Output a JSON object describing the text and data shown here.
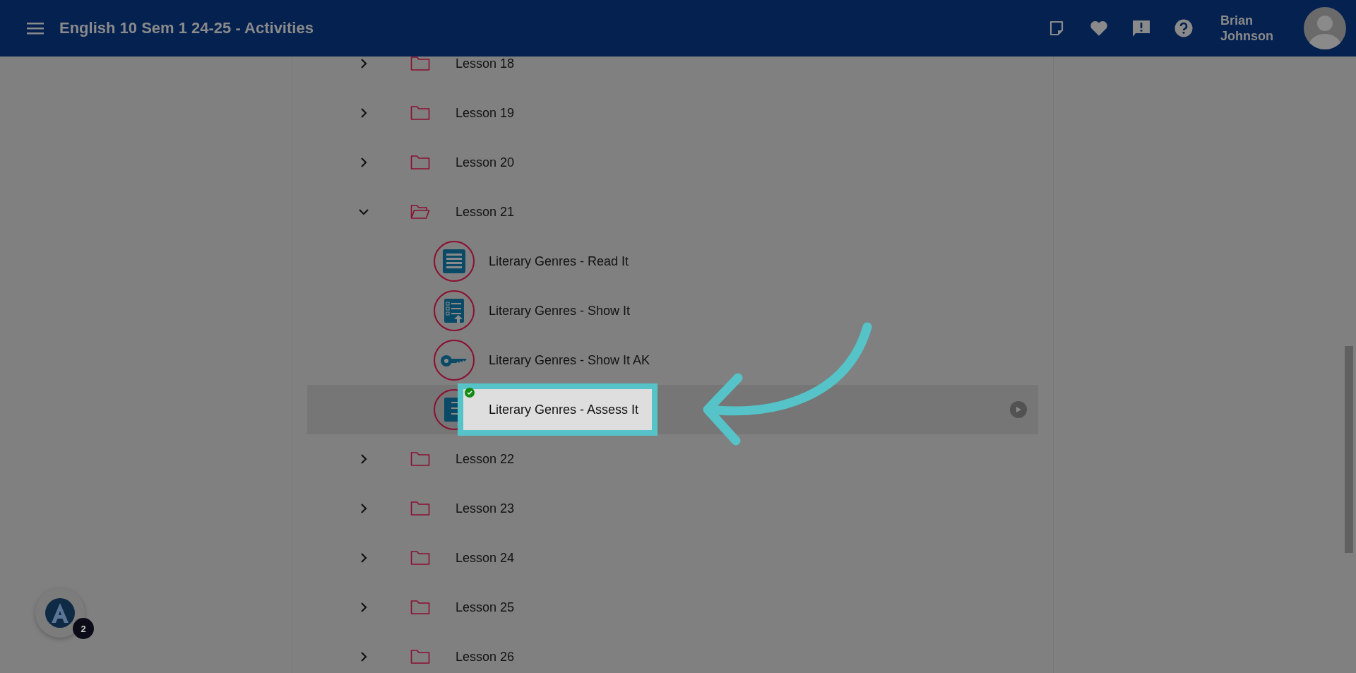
{
  "header": {
    "title": "English 10 Sem 1 24-25 - Activities",
    "user_name": "Brian Johnson"
  },
  "lessons": [
    {
      "label": "Lesson 18",
      "expanded": false
    },
    {
      "label": "Lesson 19",
      "expanded": false
    },
    {
      "label": "Lesson 20",
      "expanded": false
    },
    {
      "label": "Lesson 21",
      "expanded": true,
      "children": [
        {
          "label": "Literary Genres - Read It",
          "kind": "read",
          "selected": false,
          "completed": false
        },
        {
          "label": "Literary Genres - Show It",
          "kind": "show",
          "selected": false,
          "completed": false
        },
        {
          "label": "Literary Genres - Show It AK",
          "kind": "key",
          "selected": false,
          "completed": false
        },
        {
          "label": "Literary Genres - Assess It",
          "kind": "assess",
          "selected": true,
          "completed": true
        }
      ]
    },
    {
      "label": "Lesson 22",
      "expanded": false
    },
    {
      "label": "Lesson 23",
      "expanded": false
    },
    {
      "label": "Lesson 24",
      "expanded": false
    },
    {
      "label": "Lesson 25",
      "expanded": false
    },
    {
      "label": "Lesson 26",
      "expanded": false
    }
  ],
  "assistant": {
    "count": "2"
  }
}
